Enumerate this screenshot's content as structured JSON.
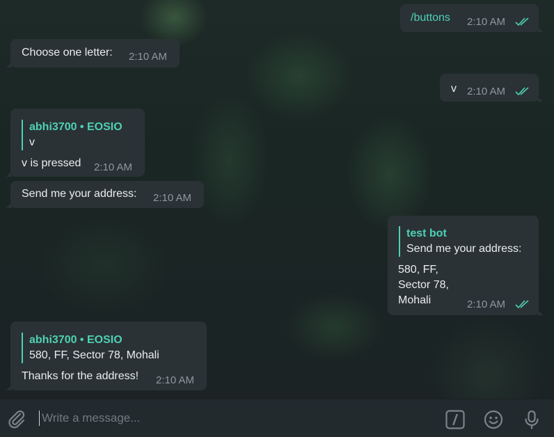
{
  "messages": {
    "m1": {
      "text": "/buttons",
      "time": "2:10 AM"
    },
    "m2": {
      "text": "Choose one letter:",
      "time": "2:10 AM"
    },
    "m3": {
      "text": "v",
      "time": "2:10 AM"
    },
    "m4": {
      "reply_name": "abhi3700 • EOSIO",
      "reply_text": "v",
      "text": "v is pressed",
      "time": "2:10 AM"
    },
    "m5": {
      "text": "Send me your address:",
      "time": "2:10 AM"
    },
    "m6": {
      "reply_name": "test bot",
      "reply_text": "Send me your address:",
      "line1": "580, FF,",
      "line2": "Sector 78,",
      "line3": "Mohali",
      "time": "2:10 AM"
    },
    "m7": {
      "reply_name": "abhi3700 • EOSIO",
      "reply_text": "580, FF,  Sector 78,  Mohali",
      "text": "Thanks for the address!",
      "time": "2:10 AM"
    }
  },
  "composer": {
    "placeholder": "Write a message..."
  },
  "icons": {
    "attach": "paperclip-icon",
    "commands": "slash-command-icon",
    "emoji": "emoji-icon",
    "voice": "microphone-icon",
    "read": "double-check-icon"
  },
  "colors": {
    "accent": "#4fd1b3",
    "bubble": "#2a3236",
    "composer": "#232a2e",
    "time": "#8d999e"
  }
}
